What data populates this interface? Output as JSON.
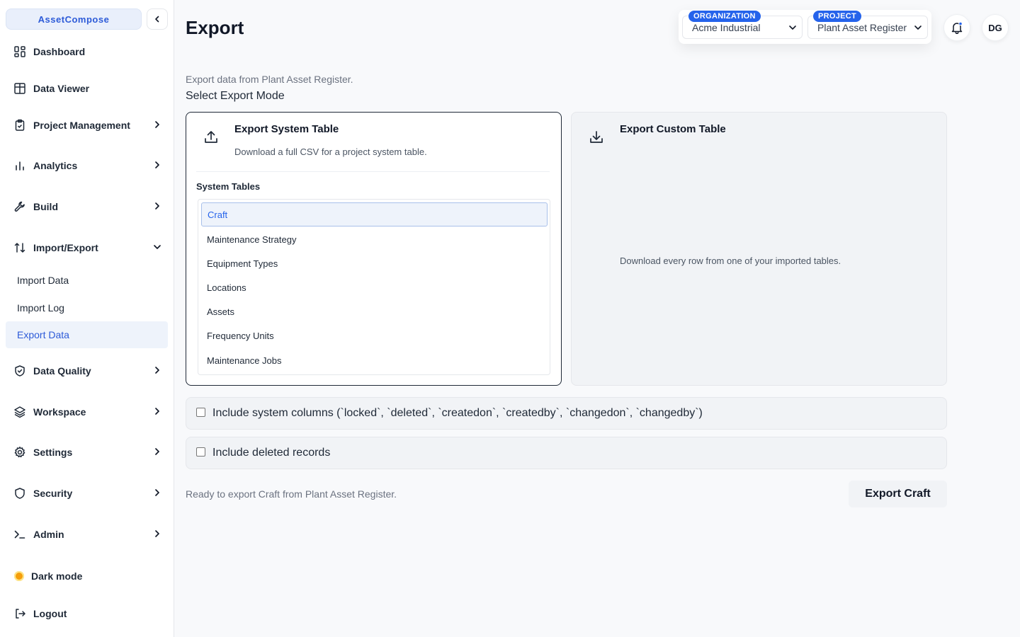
{
  "app": {
    "brand": "AssetCompose"
  },
  "sidebar": {
    "items": [
      {
        "label": "Dashboard",
        "icon": "dashboard-icon"
      },
      {
        "label": "Data Viewer",
        "icon": "table-icon"
      },
      {
        "label": "Project Management",
        "icon": "clipboard-icon"
      },
      {
        "label": "Analytics",
        "icon": "bar-chart-icon"
      },
      {
        "label": "Build",
        "icon": "wrench-icon"
      },
      {
        "label": "Import/Export",
        "icon": "arrows-updown-icon"
      },
      {
        "label": "Data Quality",
        "icon": "shield-check-icon"
      },
      {
        "label": "Workspace",
        "icon": "layers-icon"
      },
      {
        "label": "Settings",
        "icon": "gear-icon"
      },
      {
        "label": "Security",
        "icon": "shield-icon"
      },
      {
        "label": "Admin",
        "icon": "terminal-icon"
      }
    ],
    "subitems": [
      {
        "label": "Import Data"
      },
      {
        "label": "Import Log"
      },
      {
        "label": "Export Data"
      }
    ],
    "dark_mode": "Dark mode",
    "logout": "Logout"
  },
  "header": {
    "title": "Export",
    "organization": {
      "tag": "ORGANIZATION",
      "value": "Acme Industrial"
    },
    "project": {
      "tag": "PROJECT",
      "value": "Plant Asset Register"
    },
    "avatar": "DG"
  },
  "main": {
    "subtitle": "Export data from Plant Asset Register.",
    "mode_label": "Select Export Mode",
    "system_card": {
      "title": "Export System Table",
      "description": "Download a full CSV for a project system table.",
      "list_label": "System Tables",
      "tables": [
        "Craft",
        "Maintenance Strategy",
        "Equipment Types",
        "Locations",
        "Assets",
        "Frequency Units",
        "Maintenance Jobs"
      ]
    },
    "custom_card": {
      "title": "Export Custom Table",
      "description": "Download every row from one of your imported tables."
    },
    "options": {
      "system_columns": "Include system columns (`locked`, `deleted`, `createdon`, `createdby`, `changedon`, `changedby`)",
      "deleted_records": "Include deleted records"
    },
    "status": "Ready to export Craft from Plant Asset Register.",
    "export_button": "Export Craft"
  },
  "colors": {
    "accent": "#2563eb",
    "brand_bg": "#e9effb",
    "dark_mode_dot": "#f59e0b"
  }
}
